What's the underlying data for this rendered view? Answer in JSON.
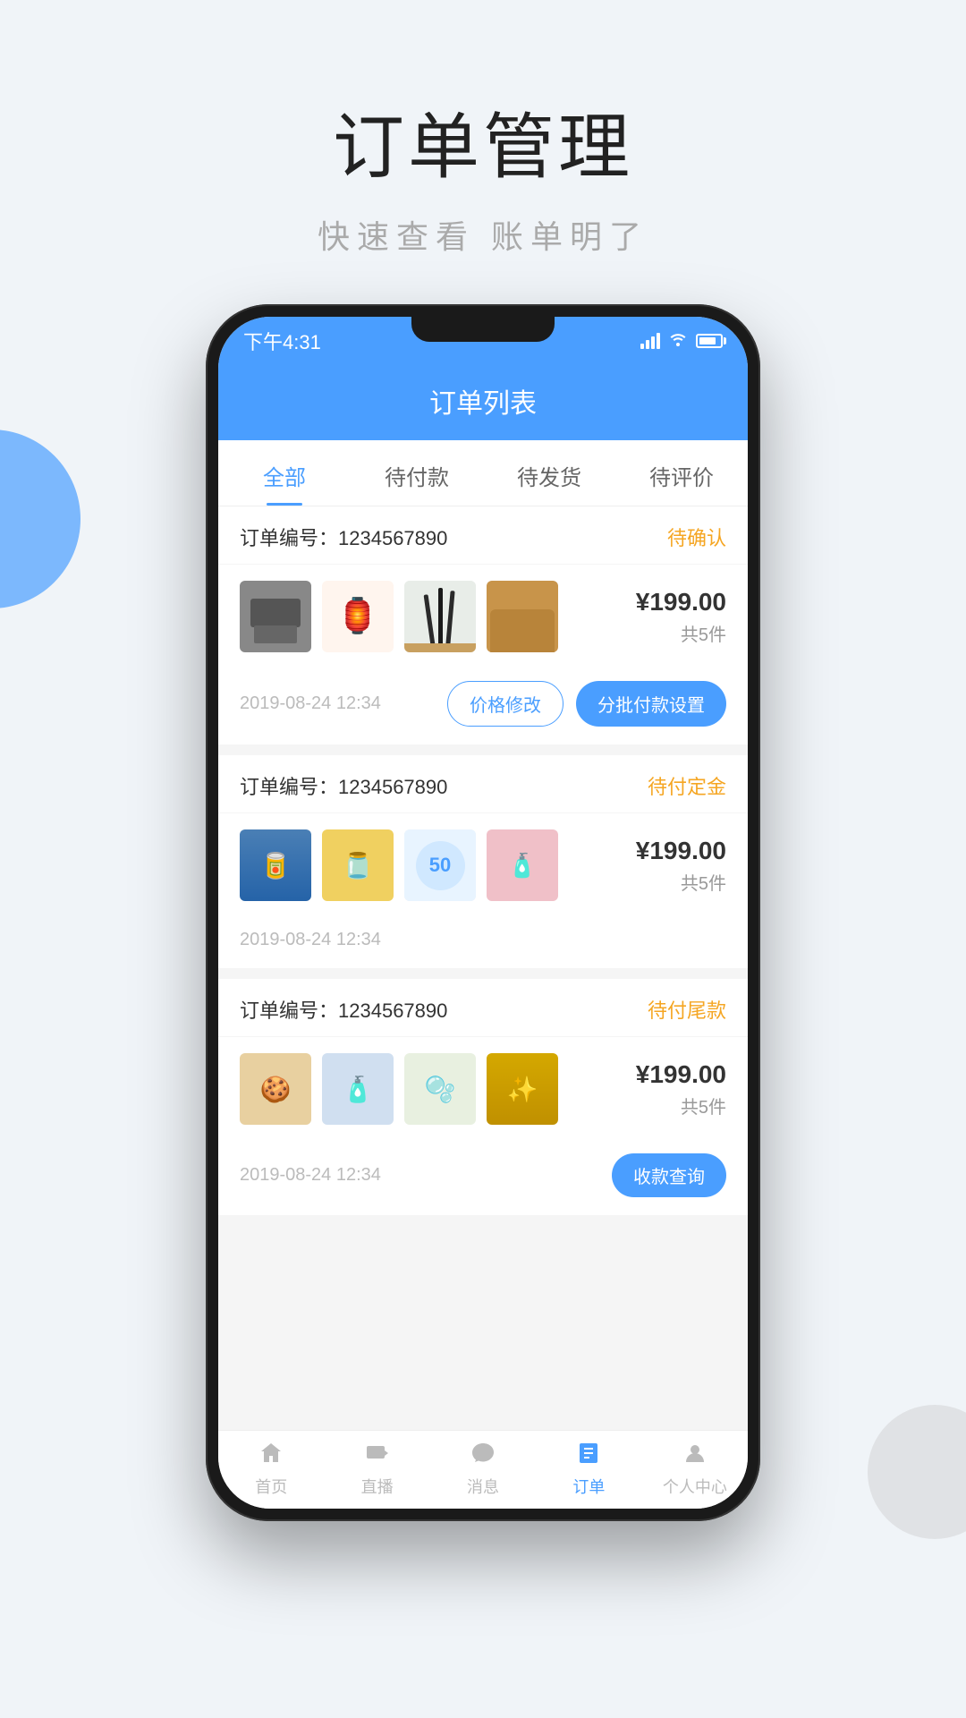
{
  "page": {
    "title": "订单管理",
    "subtitle": "快速查看 账单明了",
    "bg_circle_left": true,
    "bg_circle_right": true
  },
  "status_bar": {
    "time": "下午4:31",
    "signal": "signal",
    "wifi": "wifi",
    "battery": "battery"
  },
  "app_header": {
    "title": "订单列表"
  },
  "tabs": [
    {
      "label": "全部",
      "active": true
    },
    {
      "label": "待付款",
      "active": false
    },
    {
      "label": "待发货",
      "active": false
    },
    {
      "label": "待评价",
      "active": false
    }
  ],
  "orders": [
    {
      "id": "order-1",
      "number_label": "订单编号：",
      "number": "1234567890",
      "status": "待确认",
      "status_class": "status-confirm",
      "products": [
        {
          "type": "printer",
          "emoji": ""
        },
        {
          "type": "lantern",
          "emoji": "🏮"
        },
        {
          "type": "brushes",
          "emoji": ""
        },
        {
          "type": "sofa",
          "emoji": ""
        }
      ],
      "price": "¥199.00",
      "count": "共5件",
      "date": "2019-08-24 12:34",
      "actions": [
        {
          "label": "价格修改",
          "style": "outline"
        },
        {
          "label": "分批付款设置",
          "style": "filled"
        }
      ]
    },
    {
      "id": "order-2",
      "number_label": "订单编号：",
      "number": "1234567890",
      "status": "待付定金",
      "status_class": "status-deposit",
      "products": [
        {
          "type": "can",
          "emoji": ""
        },
        {
          "type": "sauce",
          "emoji": ""
        },
        {
          "type": "cream",
          "emoji": ""
        },
        {
          "type": "pink",
          "emoji": ""
        }
      ],
      "price": "¥199.00",
      "count": "共5件",
      "date": "2019-08-24 12:34",
      "actions": []
    },
    {
      "id": "order-3",
      "number_label": "订单编号：",
      "number": "1234567890",
      "status": "待付尾款",
      "status_class": "status-balance",
      "products": [
        {
          "type": "biscuit",
          "emoji": ""
        },
        {
          "type": "bottle",
          "emoji": ""
        },
        {
          "type": "lotion",
          "emoji": ""
        },
        {
          "type": "gold",
          "emoji": ""
        }
      ],
      "price": "¥199.00",
      "count": "共5件",
      "date": "2019-08-24 12:34",
      "actions": [
        {
          "label": "收款查询",
          "style": "filled"
        }
      ]
    }
  ],
  "bottom_nav": [
    {
      "label": "首页",
      "icon": "🏠",
      "active": false
    },
    {
      "label": "直播",
      "icon": "📺",
      "active": false
    },
    {
      "label": "消息",
      "icon": "💬",
      "active": false
    },
    {
      "label": "订单",
      "icon": "📋",
      "active": true
    },
    {
      "label": "个人中心",
      "icon": "👤",
      "active": false
    }
  ],
  "colors": {
    "brand_blue": "#4a9eff",
    "orange_status": "#f5a623",
    "text_dark": "#333",
    "text_gray": "#999",
    "text_light": "#bbb"
  }
}
